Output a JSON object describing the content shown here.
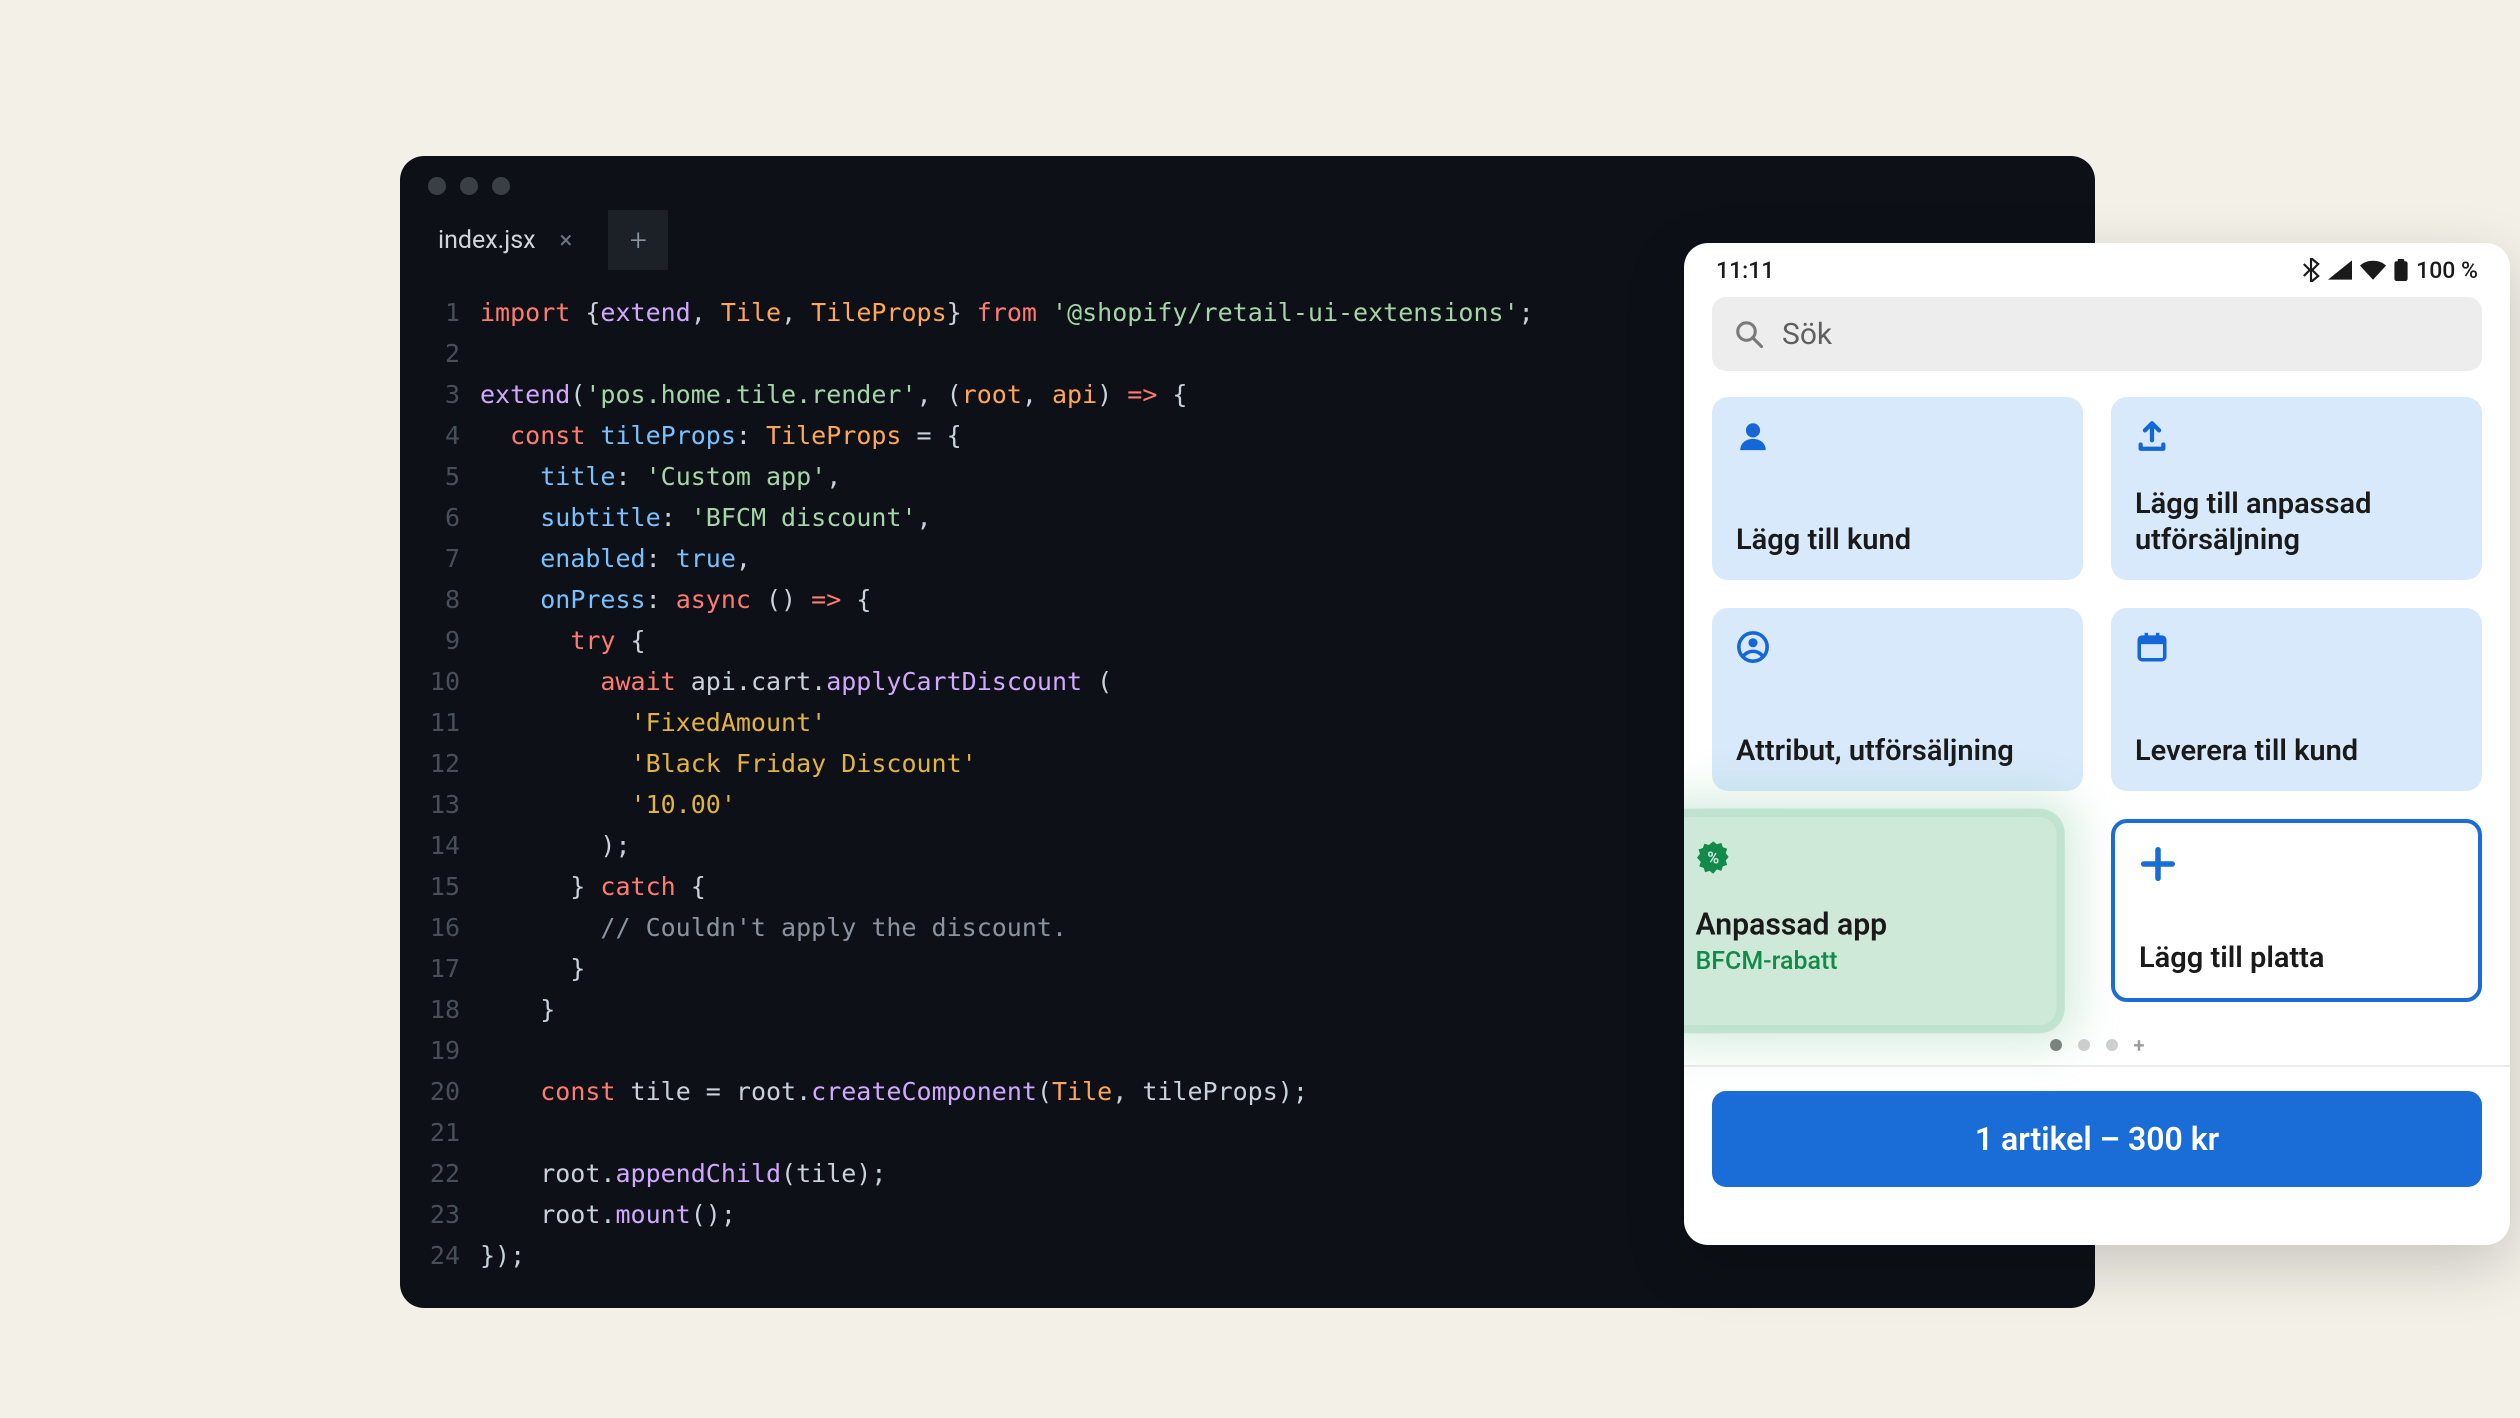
{
  "editor": {
    "tab_name": "index.jsx",
    "tab_close_glyph": "×",
    "new_tab_glyph": "+",
    "line_count": 24,
    "code_lines": [
      [
        [
          "kw",
          "import"
        ],
        [
          "punc",
          " {"
        ],
        [
          "fn",
          "extend"
        ],
        [
          "punc",
          ", "
        ],
        [
          "type",
          "Tile"
        ],
        [
          "punc",
          ", "
        ],
        [
          "type",
          "TileProps"
        ],
        [
          "punc",
          "} "
        ],
        [
          "kw",
          "from"
        ],
        [
          "punc",
          " "
        ],
        [
          "str",
          "'@shopify/retail-ui-extensions'"
        ],
        [
          "punc",
          ";"
        ]
      ],
      [
        [
          "punc",
          ""
        ]
      ],
      [
        [
          "fn",
          "extend"
        ],
        [
          "punc",
          "("
        ],
        [
          "str",
          "'pos.home.tile.render'"
        ],
        [
          "punc",
          ", ("
        ],
        [
          "type",
          "root"
        ],
        [
          "punc",
          ", "
        ],
        [
          "type",
          "api"
        ],
        [
          "punc",
          ") "
        ],
        [
          "kw",
          "=>"
        ],
        [
          "punc",
          " {"
        ]
      ],
      [
        [
          "punc",
          "  "
        ],
        [
          "kw",
          "const"
        ],
        [
          "punc",
          " "
        ],
        [
          "prop",
          "tileProps"
        ],
        [
          "punc",
          ": "
        ],
        [
          "type",
          "TileProps"
        ],
        [
          "punc",
          " = {"
        ]
      ],
      [
        [
          "punc",
          "    "
        ],
        [
          "prop",
          "title"
        ],
        [
          "punc",
          ": "
        ],
        [
          "str",
          "'Custom app'"
        ],
        [
          "punc",
          ","
        ]
      ],
      [
        [
          "punc",
          "    "
        ],
        [
          "prop",
          "subtitle"
        ],
        [
          "punc",
          ": "
        ],
        [
          "str",
          "'BFCM discount'"
        ],
        [
          "punc",
          ","
        ]
      ],
      [
        [
          "punc",
          "    "
        ],
        [
          "prop",
          "enabled"
        ],
        [
          "punc",
          ": "
        ],
        [
          "bool",
          "true"
        ],
        [
          "punc",
          ","
        ]
      ],
      [
        [
          "punc",
          "    "
        ],
        [
          "prop",
          "onPress"
        ],
        [
          "punc",
          ": "
        ],
        [
          "kw",
          "async"
        ],
        [
          "punc",
          " () "
        ],
        [
          "kw",
          "=>"
        ],
        [
          "punc",
          " {"
        ]
      ],
      [
        [
          "punc",
          "      "
        ],
        [
          "kw",
          "try"
        ],
        [
          "punc",
          " {"
        ]
      ],
      [
        [
          "punc",
          "        "
        ],
        [
          "kw",
          "await"
        ],
        [
          "punc",
          " api.cart."
        ],
        [
          "fn",
          "applyCartDiscount"
        ],
        [
          "punc",
          " ("
        ]
      ],
      [
        [
          "punc",
          "          "
        ],
        [
          "str2",
          "'FixedAmount'"
        ]
      ],
      [
        [
          "punc",
          "          "
        ],
        [
          "str2",
          "'Black Friday Discount'"
        ]
      ],
      [
        [
          "punc",
          "          "
        ],
        [
          "str2",
          "'10.00'"
        ]
      ],
      [
        [
          "punc",
          "        );"
        ]
      ],
      [
        [
          "punc",
          "      } "
        ],
        [
          "kw",
          "catch"
        ],
        [
          "punc",
          " {"
        ]
      ],
      [
        [
          "punc",
          "        "
        ],
        [
          "cmt",
          "// Couldn't apply the discount."
        ]
      ],
      [
        [
          "punc",
          "      }"
        ]
      ],
      [
        [
          "punc",
          "    }"
        ]
      ],
      [
        [
          "punc",
          ""
        ]
      ],
      [
        [
          "punc",
          "    "
        ],
        [
          "kw",
          "const"
        ],
        [
          "punc",
          " tile = root."
        ],
        [
          "fn",
          "createComponent"
        ],
        [
          "punc",
          "("
        ],
        [
          "type",
          "Tile"
        ],
        [
          "punc",
          ", tileProps);"
        ]
      ],
      [
        [
          "punc",
          ""
        ]
      ],
      [
        [
          "punc",
          "    root."
        ],
        [
          "fn",
          "appendChild"
        ],
        [
          "punc",
          "(tile);"
        ]
      ],
      [
        [
          "punc",
          "    root."
        ],
        [
          "fn",
          "mount"
        ],
        [
          "punc",
          "();"
        ]
      ],
      [
        [
          "punc",
          "});"
        ]
      ]
    ]
  },
  "device": {
    "status": {
      "time": "11:11",
      "battery_text": "100 %"
    },
    "search_placeholder": "Sök",
    "tiles": {
      "add_customer": "Lägg till kund",
      "add_custom_sale": "Lägg till anpassad utförsäljning",
      "attribute_sale": "Attribut, utförsäljning",
      "deliver_to_customer": "Leverera till kund",
      "custom_app_title": "Anpassad app",
      "custom_app_sub": "BFCM-rabatt",
      "add_tile": "Lägg till platta"
    },
    "checkout_label": "1 artikel – 300 kr"
  }
}
